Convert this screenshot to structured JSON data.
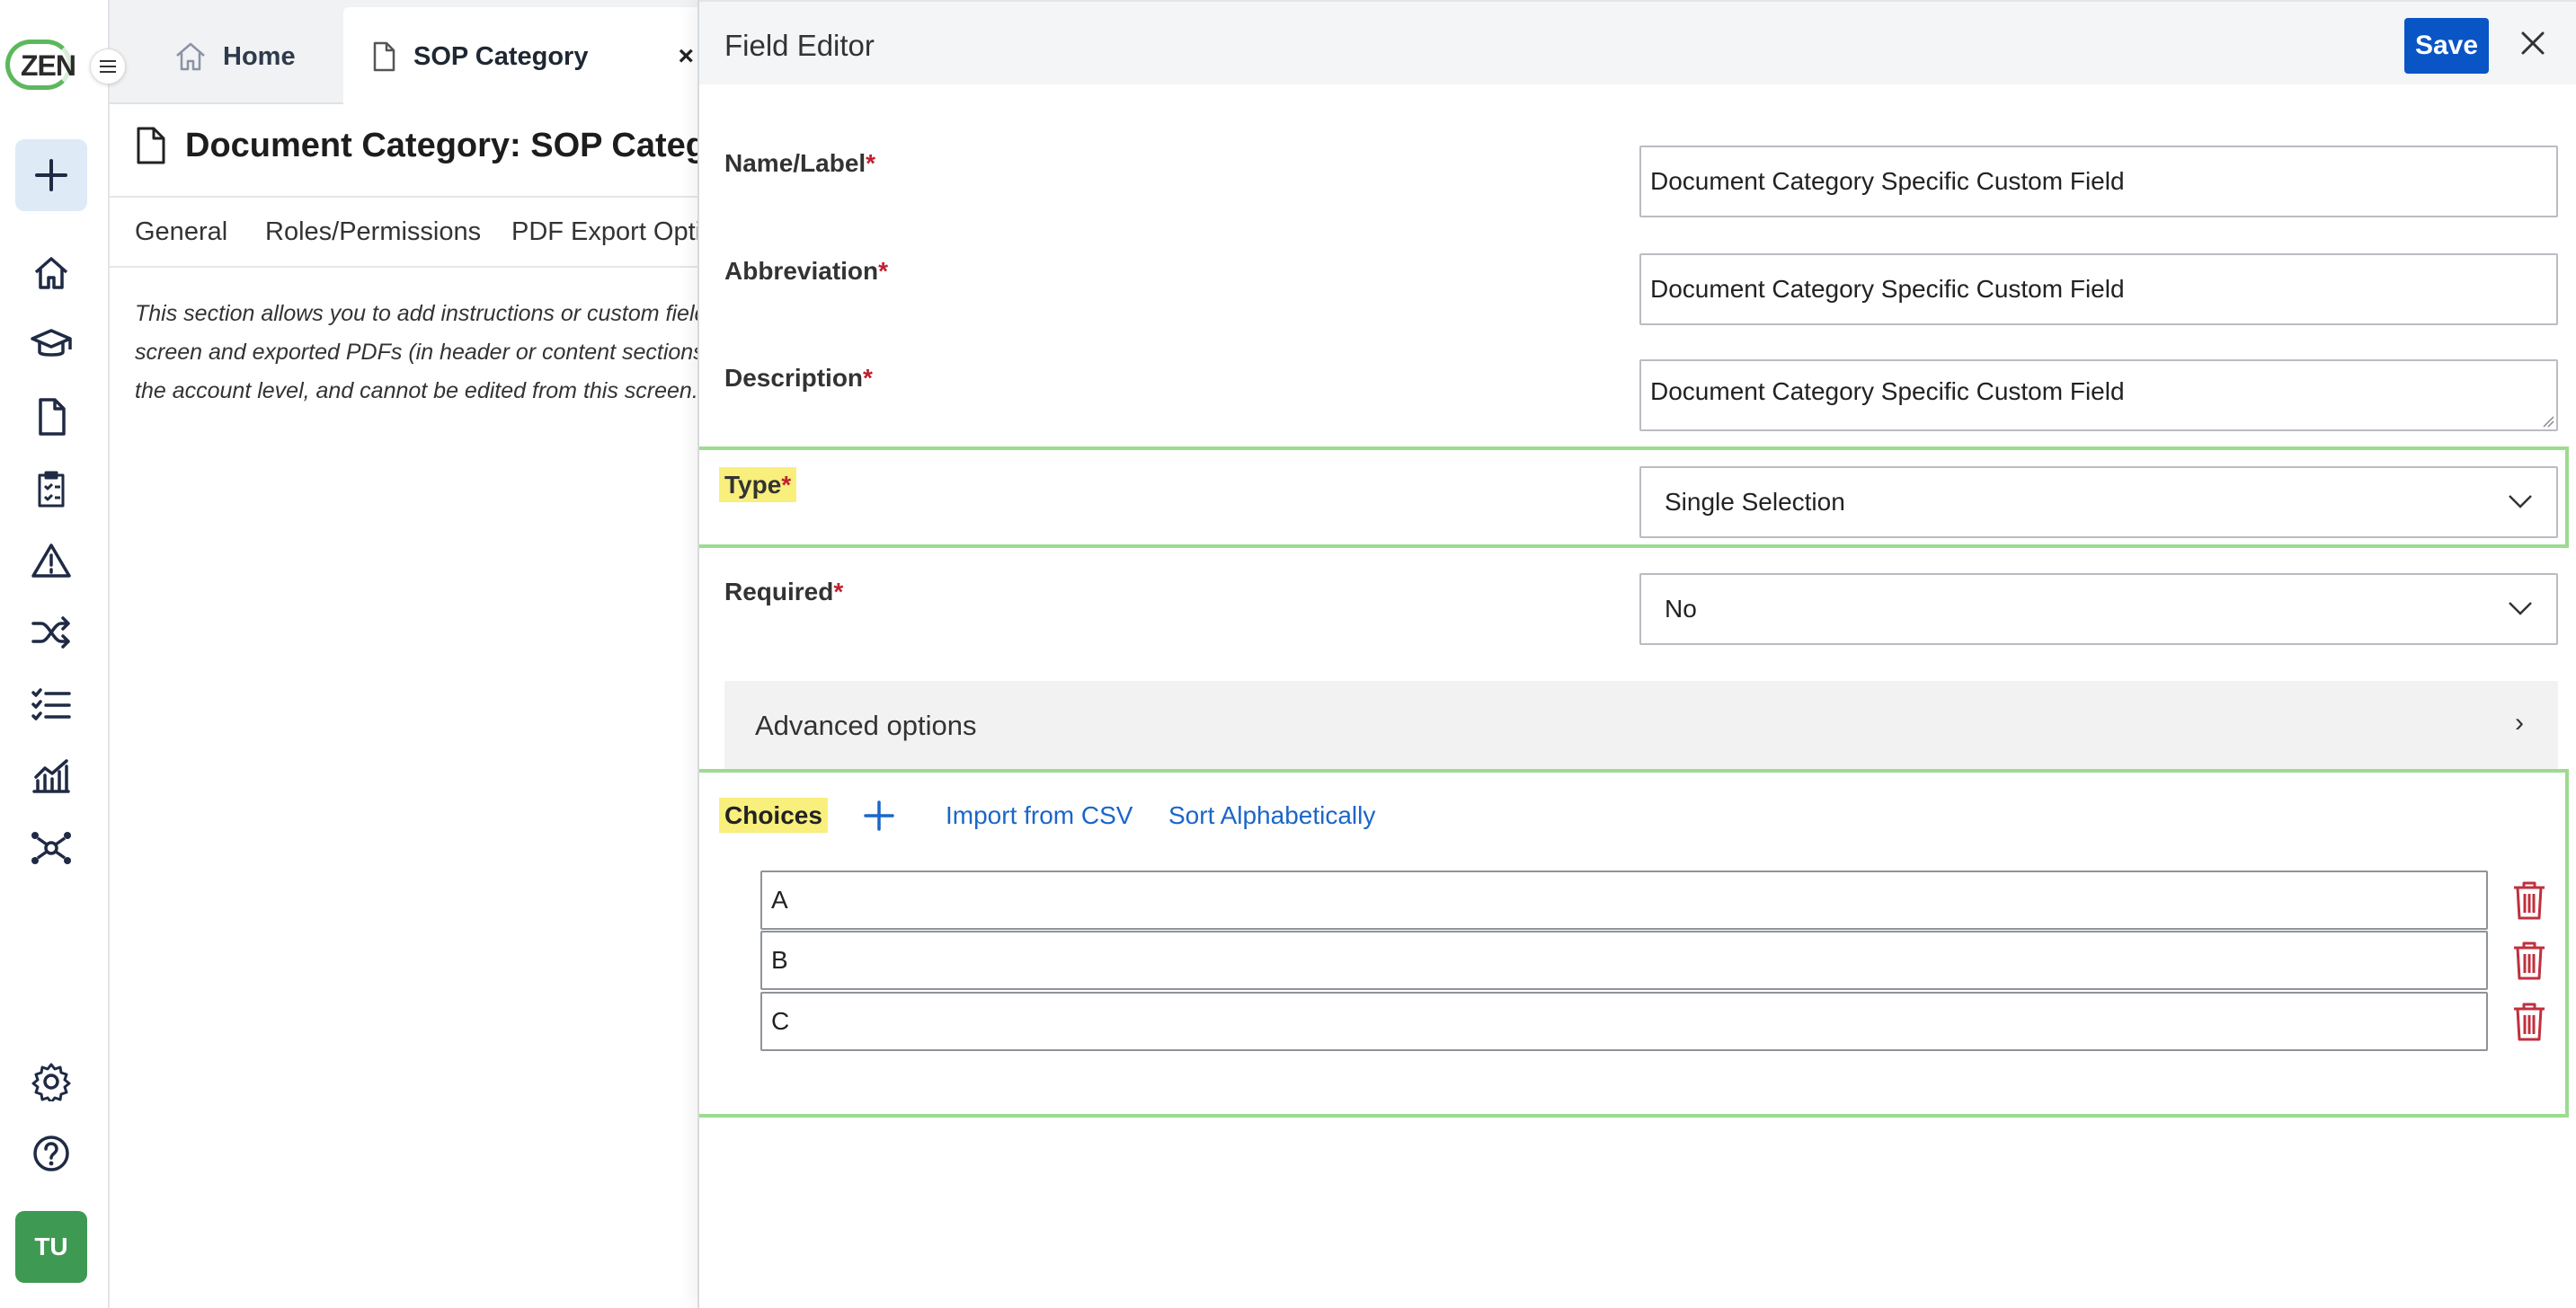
{
  "app": {
    "logo_text": "ZEN",
    "avatar_initials": "TU"
  },
  "rail": {
    "icons": [
      "add-icon",
      "home-icon",
      "graduation-cap-icon",
      "document-icon",
      "clipboard-list-icon",
      "warning-icon",
      "shuffle-icon",
      "checklist-icon",
      "chart-icon",
      "network-icon",
      "settings-icon",
      "help-icon"
    ]
  },
  "tabs": {
    "home_label": "Home",
    "sop_label": "SOP Category",
    "close_glyph": "×"
  },
  "page": {
    "title": "Document Category: SOP Category",
    "subtabs": [
      "General",
      "Roles/Permissions",
      "PDF Export Options"
    ],
    "info_text": "This section allows you to add instructions or custom fields\nscreen and exported PDFs (in header or content sections). T\nthe account level, and cannot be edited from this screen."
  },
  "editor": {
    "title": "Field Editor",
    "save_label": "Save",
    "fields": {
      "name_label": "Name/Label",
      "name_value": "Document Category Specific Custom Field",
      "abbr_label": "Abbreviation",
      "abbr_value": "Document Category Specific Custom Field",
      "desc_label": "Description",
      "desc_value": "Document Category Specific Custom Field",
      "type_label": "Type",
      "type_value": "Single Selection",
      "required_label": "Required",
      "required_value": "No",
      "required_mark": "*"
    },
    "advanced_label": "Advanced options",
    "advanced_arrow": "›",
    "choices": {
      "label": "Choices",
      "import_label": "Import from CSV",
      "sort_label": "Sort Alphabetically",
      "items": [
        "A",
        "B",
        "C"
      ]
    }
  },
  "colors": {
    "primary_button": "#0a55c5",
    "link": "#1b66c9",
    "highlight": "#f8ef7c",
    "focus_outline": "#9bdc8f",
    "delete_icon": "#c0303e",
    "avatar_bg": "#3e9a52",
    "logo_ring": "#5cb85c"
  }
}
